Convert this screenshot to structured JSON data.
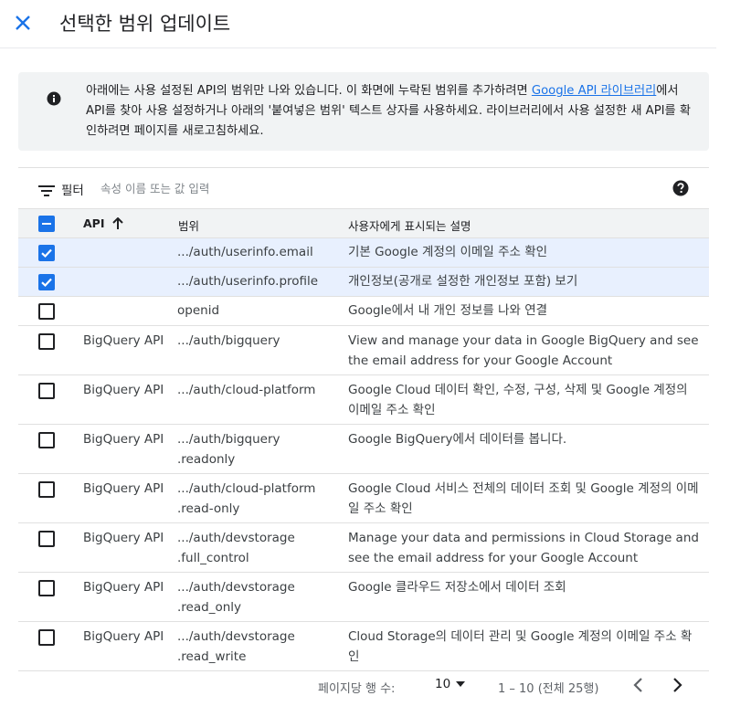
{
  "header": {
    "title": "선택한 범위 업데이트",
    "close_icon": "close-icon"
  },
  "info": {
    "text_before": "아래에는 사용 설정된 API의 범위만 나와 있습니다. 이 화면에 누락된 범위를 추가하려면 ",
    "link": "Google API 라이브러리",
    "text_after": "에서 API를 찾아 사용 설정하거나 아래의 '붙여넣은 범위' 텍스트 상자를 사용하세요. 라이브러리에서 사용 설정한 새 API를 확인하려면 페이지를 새로고침하세요."
  },
  "filter": {
    "label": "필터",
    "placeholder": "속성 이름 또는 값 입력"
  },
  "table": {
    "headers": {
      "api": "API",
      "scope": "범위",
      "desc": "사용자에게 표시되는 설명"
    },
    "rows": [
      {
        "checked": true,
        "api": "",
        "scope": ".../auth/userinfo.email",
        "desc": "기본 Google 계정의 이메일 주소 확인"
      },
      {
        "checked": true,
        "api": "",
        "scope": ".../auth/userinfo.profile",
        "desc": "개인정보(공개로 설정한 개인정보 포함) 보기"
      },
      {
        "checked": false,
        "api": "",
        "scope": "openid",
        "desc": "Google에서 내 개인 정보를 나와 연결"
      },
      {
        "checked": false,
        "api": "BigQuery API",
        "scope": ".../auth/bigquery",
        "desc": "View and manage your data in Google BigQuery and see the email address for your Google Account"
      },
      {
        "checked": false,
        "api": "BigQuery API",
        "scope": ".../auth/cloud-platform",
        "desc": "Google Cloud 데이터 확인, 수정, 구성, 삭제 및 Google 계정의 이메일 주소 확인"
      },
      {
        "checked": false,
        "api": "BigQuery API",
        "scope": ".../auth/bigquery .readonly",
        "desc": "Google BigQuery에서 데이터를 봅니다."
      },
      {
        "checked": false,
        "api": "BigQuery API",
        "scope": ".../auth/cloud-platform .read-only",
        "desc": "Google Cloud 서비스 전체의 데이터 조회 및 Google 계정의 이메일 주소 확인"
      },
      {
        "checked": false,
        "api": "BigQuery API",
        "scope": ".../auth/devstorage .full_control",
        "desc": "Manage your data and permissions in Cloud Storage and see the email address for your Google Account"
      },
      {
        "checked": false,
        "api": "BigQuery API",
        "scope": ".../auth/devstorage .read_only",
        "desc": "Google 클라우드 저장소에서 데이터 조회"
      },
      {
        "checked": false,
        "api": "BigQuery API",
        "scope": ".../auth/devstorage .read_write",
        "desc": "Cloud Storage의 데이터 관리 및 Google 계정의 이메일 주소 확인"
      }
    ]
  },
  "pager": {
    "rows_label": "페이지당 행 수:",
    "rows_value": "10",
    "range": "1 – 10 (전체 25행)"
  },
  "colors": {
    "accent": "#1a73e8",
    "selected_row": "#e8f0fe",
    "header_bg": "#f1f3f4"
  }
}
